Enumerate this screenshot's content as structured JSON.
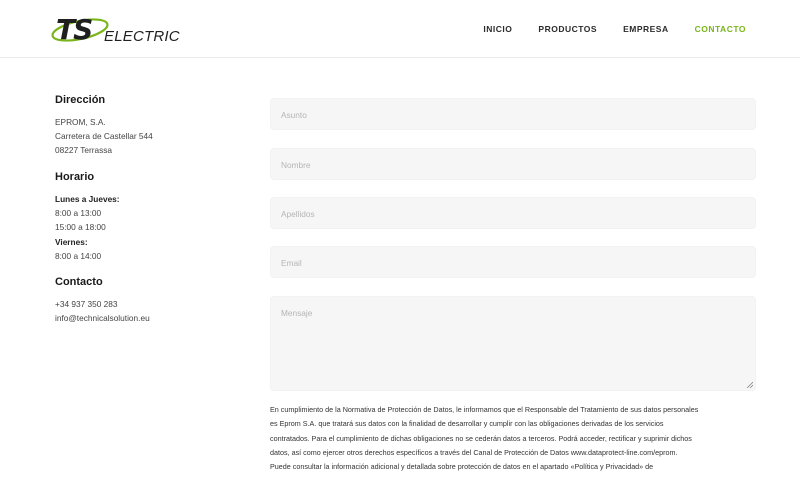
{
  "brand": {
    "logo_ts": "TS",
    "logo_electric": "ELECTRIC",
    "accent": "#7ab51d"
  },
  "nav": [
    {
      "label": "INICIO"
    },
    {
      "label": "PRODUCTOS"
    },
    {
      "label": "EMPRESA"
    },
    {
      "label": "CONTACTO",
      "active": true
    }
  ],
  "direccion": {
    "title": "Dirección",
    "lines": [
      "EPROM, S.A.",
      "Carretera de Castellar 544",
      "08227 Terrassa"
    ]
  },
  "horario": {
    "title": "Horario",
    "lunes_label": "Lunes a Jueves:",
    "lunes_lines": [
      "8:00 a 13:00",
      "15:00 a 18:00"
    ],
    "viernes_label": "Viernes:",
    "viernes_lines": [
      "8:00 a 14:00"
    ]
  },
  "contacto": {
    "title": "Contacto",
    "phone": "+34 937 350 283",
    "email": "info@technicalsolution.eu"
  },
  "form": {
    "asunto": "Asunto",
    "nombre": "Nombre",
    "apellidos": "Apellidos",
    "email": "Email",
    "mensaje": "Mensaje"
  },
  "legal": [
    "En cumplimiento de la Normativa de Protección de Datos, le informamos que el Responsable del Tratamiento de sus datos personales",
    "es Eprom S.A. que tratará sus datos con la finalidad de desarrollar y cumplir con las obligaciones derivadas de los servicios",
    "contratados. Para el cumplimiento de dichas obligaciones no se cederán datos a terceros. Podrá acceder, rectificar y suprimir dichos",
    "datos, así como ejercer otros derechos específicos a través del Canal de Protección de Datos www.dataprotect-line.com/eprom.",
    "Puede consultar la información adicional y detallada sobre protección de datos en el apartado «Política y Privacidad» de"
  ]
}
